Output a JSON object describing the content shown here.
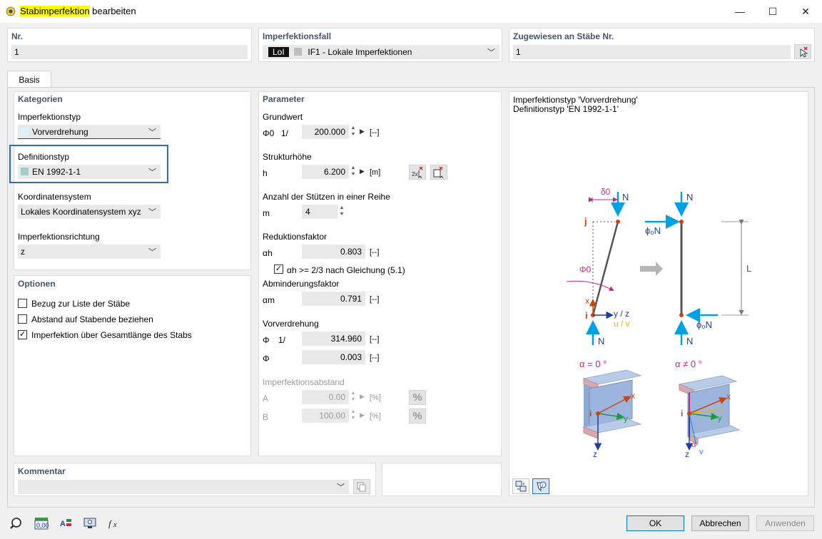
{
  "window": {
    "title_highlight": "Stabimperfektion",
    "title_rest": " bearbeiten",
    "minimize": "—",
    "maximize": "☐",
    "close": "✕"
  },
  "header": {
    "nr_label": "Nr.",
    "nr_value": "1",
    "case_label": "Imperfektionsfall",
    "case_tag": "LoI",
    "case_value": "IF1 - Lokale Imperfektionen",
    "assigned_label": "Zugewiesen an Stäbe Nr.",
    "assigned_value": "1"
  },
  "tabs": [
    "Basis"
  ],
  "kategorien": {
    "heading": "Kategorien",
    "imperfektionstyp_label": "Imperfektionstyp",
    "imperfektionstyp_value": "Vorverdrehung",
    "definitionstyp_label": "Definitionstyp",
    "definitionstyp_value": "EN 1992-1-1",
    "koordinatensystem_label": "Koordinatensystem",
    "koordinatensystem_value": "Lokales Koordinatensystem xyz",
    "richtung_label": "Imperfektionsrichtung",
    "richtung_value": "z"
  },
  "optionen": {
    "heading": "Optionen",
    "items": [
      {
        "label": "Bezug zur Liste der Stäbe",
        "checked": false
      },
      {
        "label": "Abstand auf Stabende beziehen",
        "checked": false
      },
      {
        "label": "Imperfektion über Gesamtlänge des Stabs",
        "checked": true
      }
    ]
  },
  "parameter": {
    "heading": "Parameter",
    "grundwert_label": "Grundwert",
    "grundwert_sym": "Φ0",
    "grundwert_prefix": "1/",
    "grundwert_value": "200.000",
    "grundwert_unit": "[--]",
    "struktur_label": "Strukturhöhe",
    "struktur_sym": "h",
    "struktur_value": "6.200",
    "struktur_unit": "[m]",
    "stuetzen_label": "Anzahl der Stützen in einer Reihe",
    "stuetzen_sym": "m",
    "stuetzen_value": "4",
    "reduktion_label": "Reduktionsfaktor",
    "reduktion_sym": "αh",
    "reduktion_value": "0.803",
    "reduktion_unit": "[--]",
    "reduktion_check_label": "αh >= 2/3 nach Gleichung (5.1)",
    "abminderung_label": "Abminderungsfaktor",
    "abminderung_sym": "αm",
    "abminderung_value": "0.791",
    "abminderung_unit": "[--]",
    "vorverdrehung_label": "Vorverdrehung",
    "v1_sym": "Φ",
    "v1_prefix": "1/",
    "v1_value": "314.960",
    "v1_unit": "[--]",
    "v2_sym": "Φ",
    "v2_value": "0.003",
    "v2_unit": "[--]",
    "abstand_label": "Imperfektionsabstand",
    "a_sym": "A",
    "a_value": "0.00",
    "a_unit": "[%]",
    "b_sym": "B",
    "b_value": "100.00",
    "b_unit": "[%]",
    "percent": "%"
  },
  "preview": {
    "line1": "Imperfektionstyp 'Vorverdrehung'",
    "line2": "Definitionstyp 'EN 1992-1-1'",
    "labels": {
      "delta0": "δ0",
      "N": "N",
      "j": "j",
      "i": "i",
      "phi0": "Φ0",
      "x": "x",
      "yz": "y / z",
      "uv": "u / v",
      "phiN": "ϕ₀N",
      "L": "L",
      "alpha0": "α = 0 °",
      "alphaNe": "α ≠ 0 °",
      "y": "y",
      "z": "z",
      "u": "u",
      "v": "v",
      "alpha": "α"
    }
  },
  "kommentar": {
    "label": "Kommentar",
    "value": ""
  },
  "buttons": {
    "ok": "OK",
    "cancel": "Abbrechen",
    "apply": "Anwenden"
  },
  "colors": {
    "accent_blue": "#00a0e6",
    "magenta": "#c8287d",
    "orange_red": "#c84614",
    "focus_border": "#2f6bb5"
  }
}
